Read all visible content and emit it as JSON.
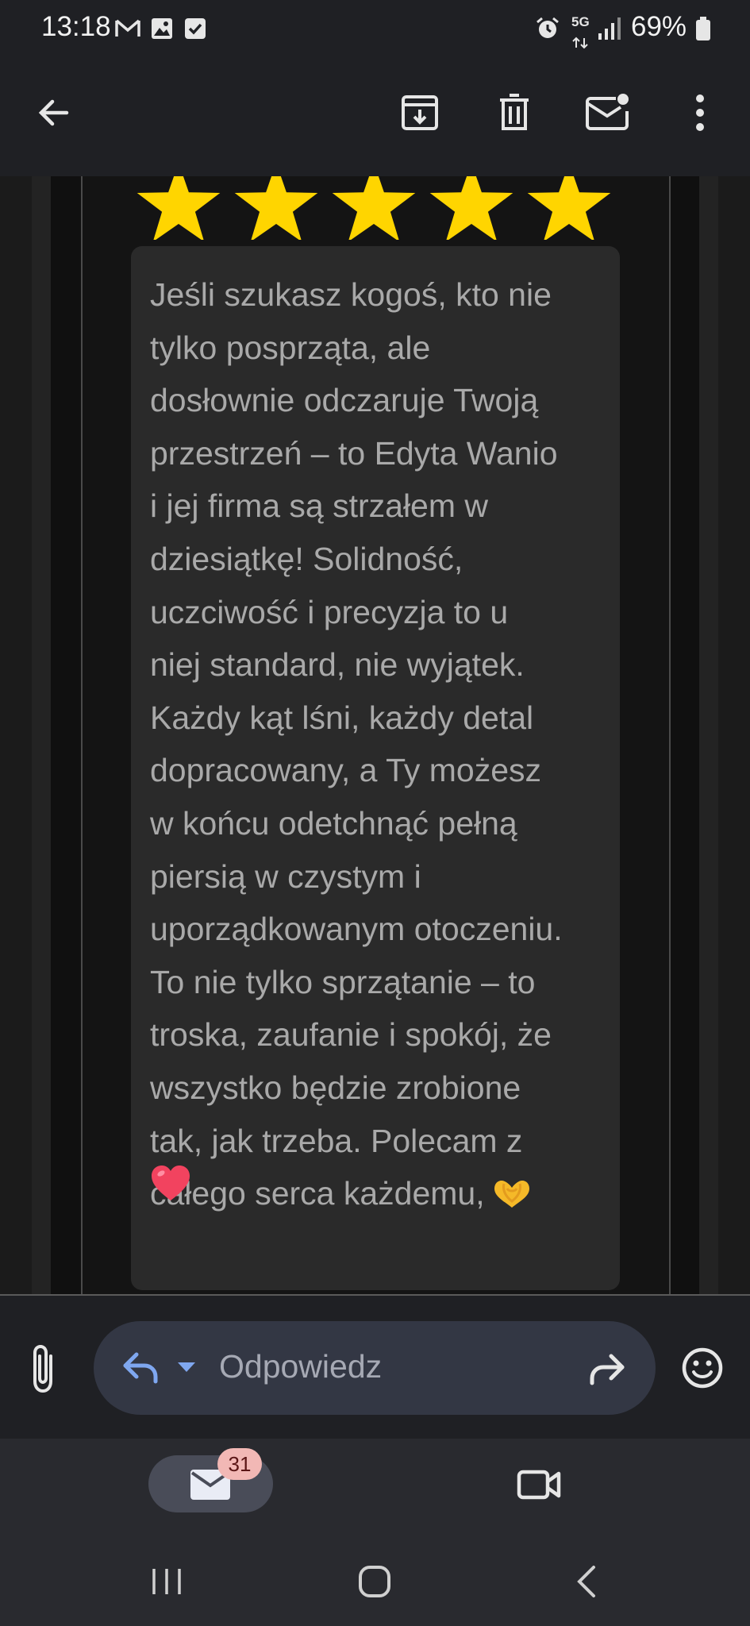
{
  "status_bar": {
    "time": "13:18",
    "network": "5G",
    "battery": "69%"
  },
  "toolbar": {
    "back": "arrow-back-icon",
    "archive": "archive-icon",
    "delete": "trash-icon",
    "mark_unread": "mark-unread-icon",
    "more": "more-vert-icon"
  },
  "rating": {
    "stars": 5,
    "max": 5,
    "color": "#ffd500"
  },
  "review": {
    "text": "Jeśli szukasz kogoś, kto nie\ntylko posprząta, ale\ndosłownie odczaruje Twoją\nprzestrzeń – to Edyta Wanio\ni jej firma są strzałem w\ndziesiątkę! Solidność,\nuczciwość i precyzja to u\nniej standard, nie wyjątek.\nKażdy kąt lśni, każdy detal\ndopracowany, a Ty możesz\nw końcu odetchnąć pełną\npiersią w czystym i\nuporządkowanym otoczeniu.\nTo nie tylko sprzątanie – to\ntroska, zaufanie i spokój, że\nwszystko będzie zrobione\ntak, jak trzeba. Polecam z\ncałego serca każdemu,",
    "emoji": [
      "heart-hands-emoji",
      "red-heart-emoji"
    ]
  },
  "reply_bar": {
    "placeholder": "Odpowiedz",
    "attach": "attach-icon",
    "reply": "reply-icon",
    "forward": "forward-icon",
    "emoji": "emoji-icon"
  },
  "bottom_nav": {
    "mail_badge": "31",
    "mail": "mail-icon",
    "meet": "video-icon"
  },
  "colors": {
    "background": "#1f2024",
    "card": "#2a2a2a",
    "accent": "#7fa7f0",
    "badge": "#f2b8b5"
  }
}
